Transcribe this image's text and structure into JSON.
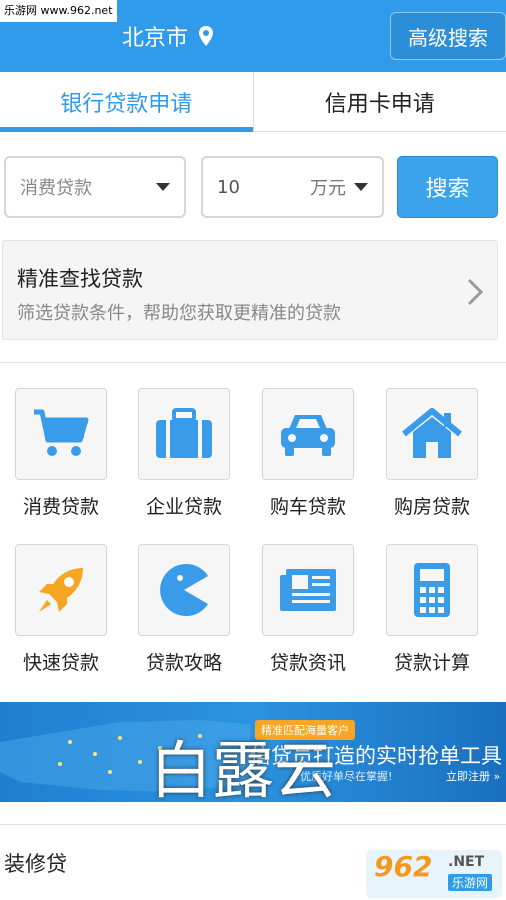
{
  "watermark": "乐游网 www.962.net",
  "header": {
    "city": "北京市",
    "location_icon": "location-pin-icon",
    "advanced_search": "高级搜索"
  },
  "tabs": [
    {
      "label": "银行贷款申请",
      "active": true
    },
    {
      "label": "信用卡申请",
      "active": false
    }
  ],
  "search": {
    "loan_type": "消费贷款",
    "amount": "10",
    "unit": "万元",
    "button": "搜索"
  },
  "precise": {
    "title": "精准查找贷款",
    "desc": "筛选贷款条件，帮助您获取更精准的贷款"
  },
  "categories": [
    {
      "label": "消费贷款",
      "icon": "shopping-cart-icon"
    },
    {
      "label": "企业贷款",
      "icon": "briefcase-icon"
    },
    {
      "label": "购车贷款",
      "icon": "car-icon"
    },
    {
      "label": "购房贷款",
      "icon": "house-icon"
    },
    {
      "label": "快速贷款",
      "icon": "rocket-icon"
    },
    {
      "label": "贷款攻略",
      "icon": "pacman-icon"
    },
    {
      "label": "贷款资讯",
      "icon": "newspaper-icon"
    },
    {
      "label": "贷款计算",
      "icon": "calculator-icon"
    }
  ],
  "banner": {
    "tag": "精准匹配海量客户",
    "slogan": "信贷员打造的实时抢单工具",
    "sub": "优质好单尽在掌握!",
    "register": "立即注册 »",
    "overlay": "白露云"
  },
  "section": {
    "title": "装修贷"
  },
  "logo": {
    "num": "962",
    "net": ".NET",
    "cn": "乐游网"
  },
  "colors": {
    "primary": "#2f9bea",
    "icon_blue": "#3a9be8",
    "rocket_orange": "#f6a623"
  }
}
